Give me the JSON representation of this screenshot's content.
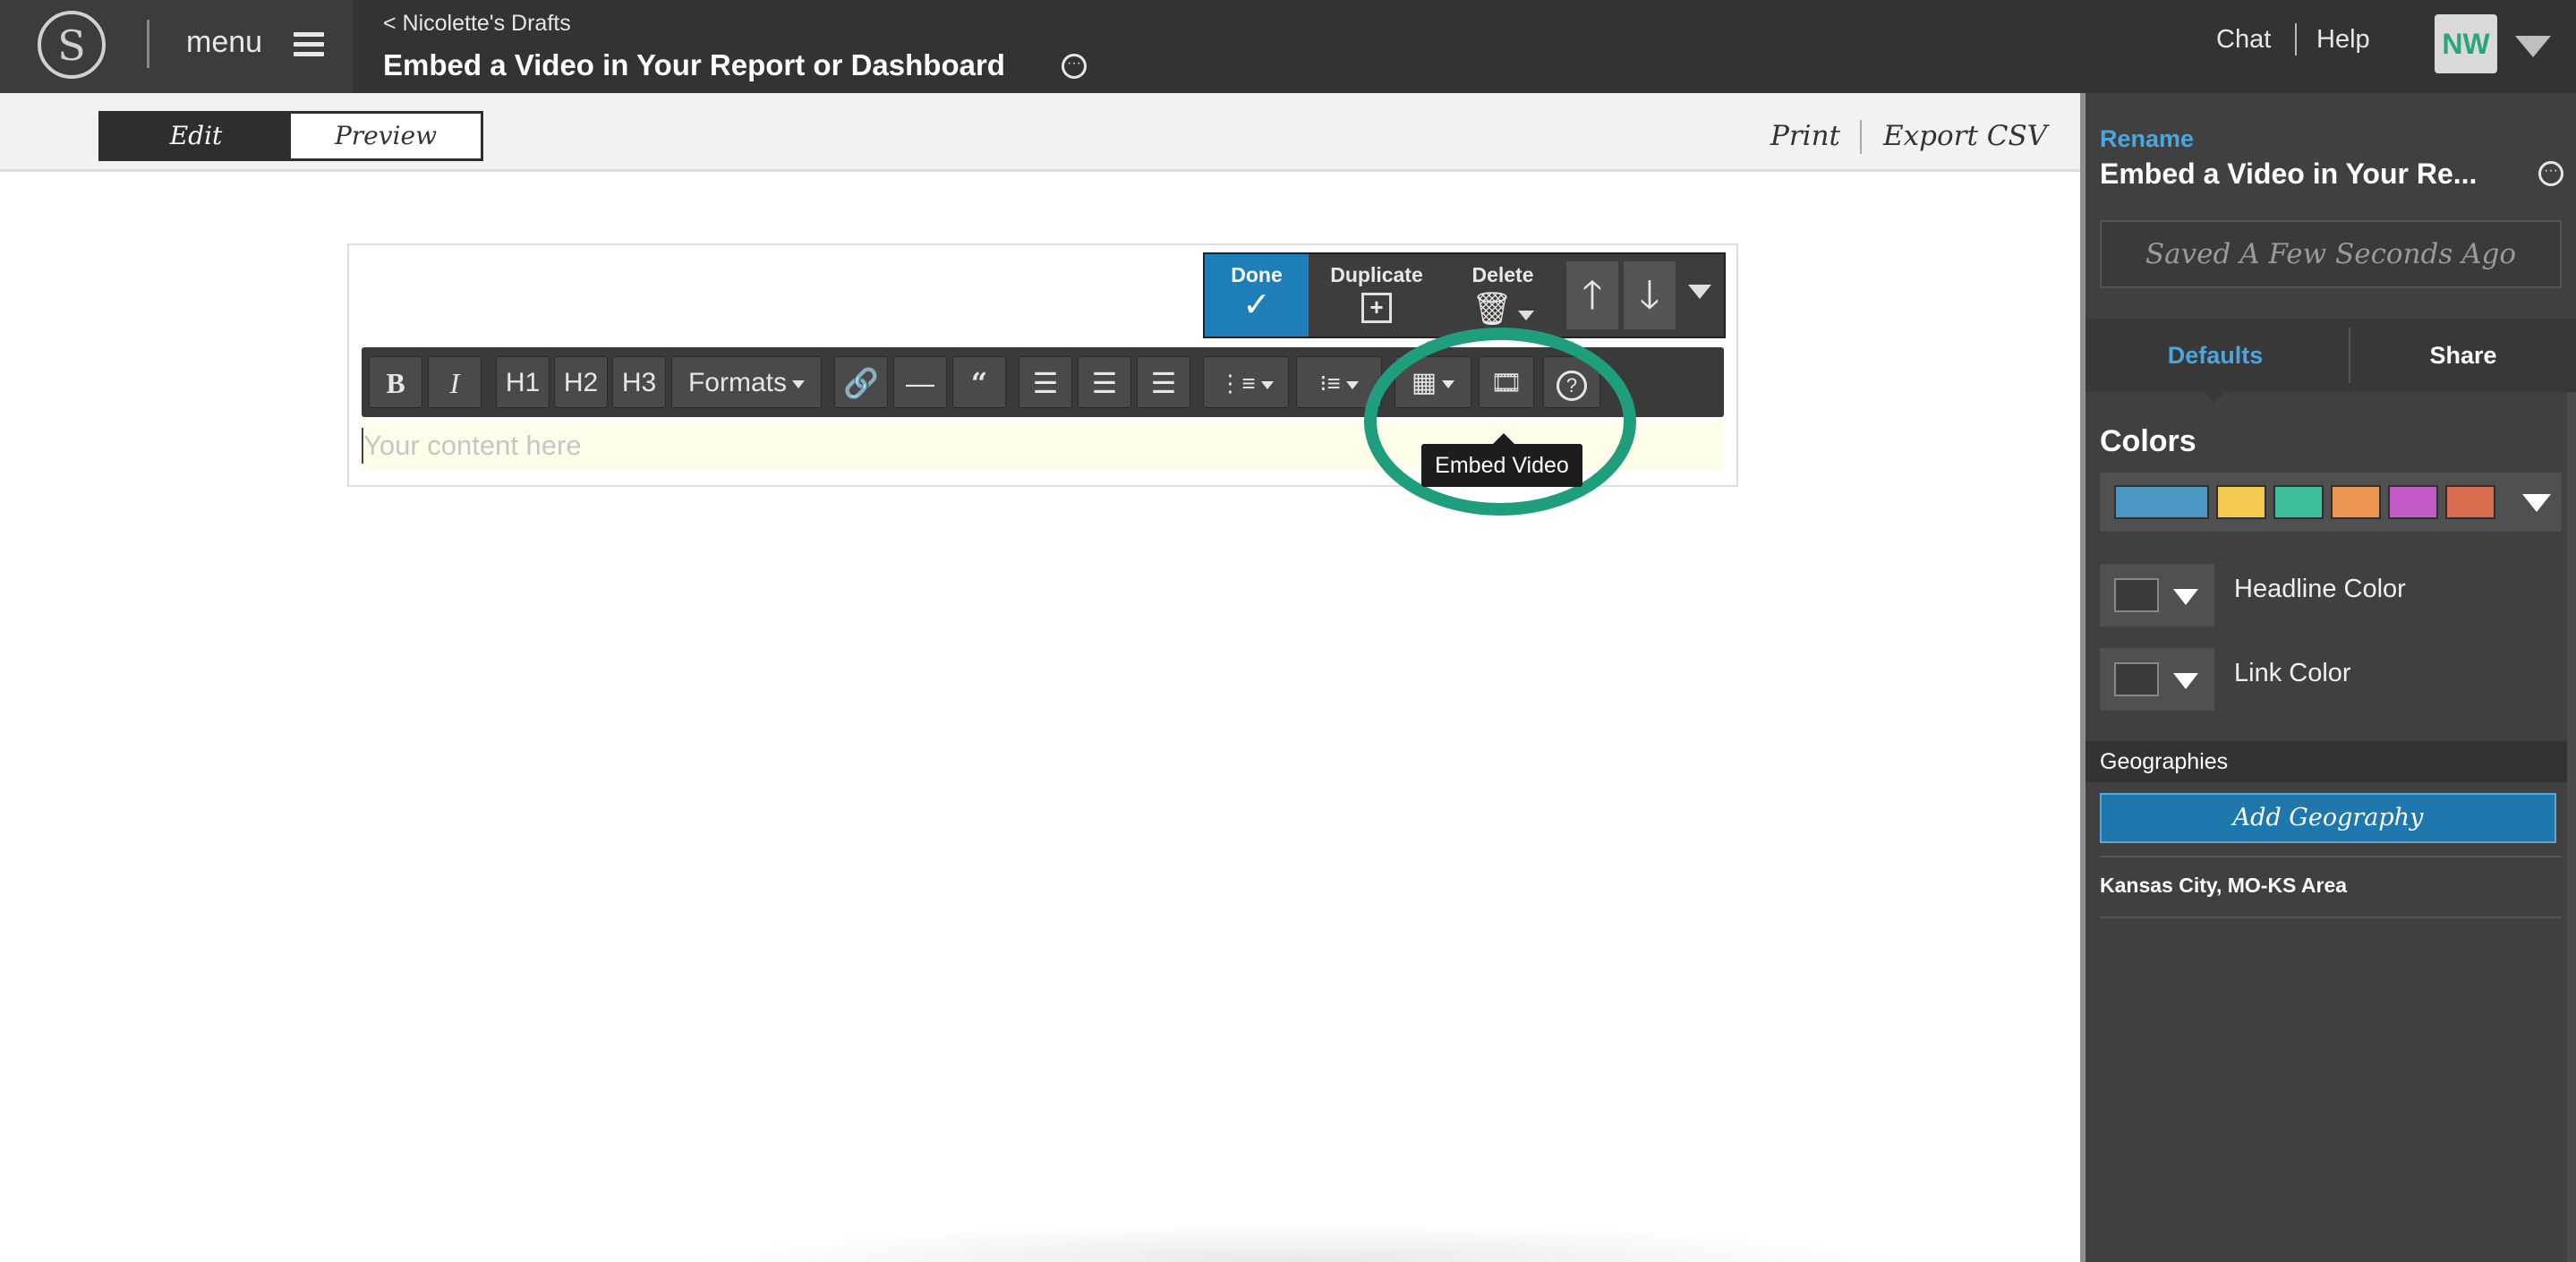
{
  "header": {
    "logo_letter": "S",
    "menu_label": "menu",
    "breadcrumb": "< Nicolette's Drafts",
    "title": "Embed a Video in Your Report or Dashboard",
    "chat": "Chat",
    "help": "Help",
    "avatar_initials": "NW"
  },
  "subbar": {
    "edit": "Edit",
    "preview": "Preview",
    "print": "Print",
    "export": "Export CSV"
  },
  "block_actions": {
    "done": "Done",
    "duplicate": "Duplicate",
    "delete": "Delete"
  },
  "editor": {
    "toolbar": {
      "bold": "B",
      "italic": "I",
      "h1": "H1",
      "h2": "H2",
      "h3": "H3",
      "formats": "Formats"
    },
    "placeholder": "Your content here",
    "tooltip": "Embed Video"
  },
  "panel": {
    "rename": "Rename",
    "title": "Embed a Video in Your Re...",
    "saved": "Saved A Few Seconds Ago",
    "tabs": [
      "Defaults",
      "Share"
    ],
    "colors_heading": "Colors",
    "palette": [
      "#4a97c6",
      "#f2c94c",
      "#3dbf9c",
      "#ec9550",
      "#c25ac8",
      "#db6b4f"
    ],
    "headline_color": "Headline Color",
    "link_color": "Link Color",
    "geographies_heading": "Geographies",
    "add_geography": "Add Geography",
    "geography_item": "Kansas City, MO-KS Area"
  },
  "colors": {
    "accent_blue": "#1e7fb8",
    "link_blue": "#4aa6df",
    "highlight_ring": "#1f9e7d",
    "avatar_text": "#2aa57b"
  }
}
